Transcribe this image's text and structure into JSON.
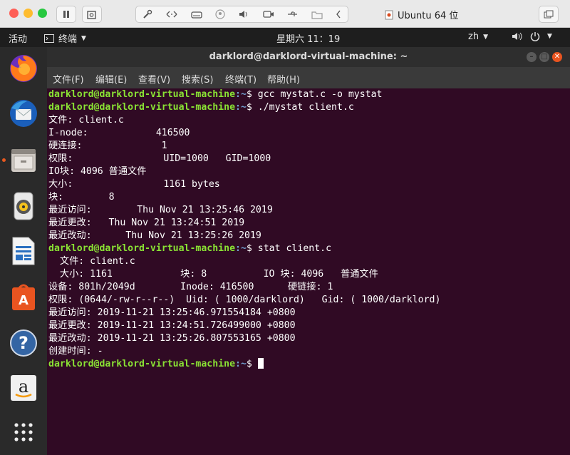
{
  "host": {
    "window_title": "Ubuntu 64 位"
  },
  "panel": {
    "activities": "活动",
    "app_name": "终端",
    "clock": "星期六 11：19",
    "input_method": "zh"
  },
  "terminal": {
    "title": "darklord@darklord-virtual-machine: ~",
    "menu": [
      "文件(F)",
      "编辑(E)",
      "查看(V)",
      "搜索(S)",
      "终端(T)",
      "帮助(H)"
    ],
    "prompt_user": "darklord@darklord-virtual-machine",
    "prompt_path": ":~",
    "prompt_symbol": "$ ",
    "lines": [
      {
        "type": "prompt",
        "cmd": "gcc mystat.c -o mystat"
      },
      {
        "type": "prompt",
        "cmd": "./mystat client.c"
      },
      {
        "type": "out",
        "text": "文件: client.c"
      },
      {
        "type": "out",
        "text": "I-node:            416500"
      },
      {
        "type": "out",
        "text": "硬连接:              1"
      },
      {
        "type": "out",
        "text": "权限:                UID=1000   GID=1000"
      },
      {
        "type": "out",
        "text": "IO块: 4096 普通文件"
      },
      {
        "type": "out",
        "text": "大小:                1161 bytes"
      },
      {
        "type": "out",
        "text": "块:        8"
      },
      {
        "type": "out",
        "text": "最近访问:        Thu Nov 21 13:25:46 2019"
      },
      {
        "type": "out",
        "text": "最近更改:   Thu Nov 21 13:24:51 2019"
      },
      {
        "type": "out",
        "text": "最近改动:      Thu Nov 21 13:25:26 2019"
      },
      {
        "type": "prompt",
        "cmd": "stat client.c"
      },
      {
        "type": "out",
        "text": "  文件: client.c"
      },
      {
        "type": "out",
        "text": "  大小: 1161            块: 8          IO 块: 4096   普通文件"
      },
      {
        "type": "out",
        "text": "设备: 801h/2049d        Inode: 416500      硬链接: 1"
      },
      {
        "type": "out",
        "text": "权限: (0644/-rw-r--r--)  Uid: ( 1000/darklord)   Gid: ( 1000/darklord)"
      },
      {
        "type": "out",
        "text": "最近访问: 2019-11-21 13:25:46.971554184 +0800"
      },
      {
        "type": "out",
        "text": "最近更改: 2019-11-21 13:24:51.726499000 +0800"
      },
      {
        "type": "out",
        "text": "最近改动: 2019-11-21 13:25:26.807553165 +0800"
      },
      {
        "type": "out",
        "text": "创建时间: -"
      },
      {
        "type": "prompt",
        "cmd": ""
      }
    ]
  },
  "dock": {
    "apps": [
      "firefox-icon",
      "thunderbird-icon",
      "files-icon",
      "rhythmbox-icon",
      "libreoffice-writer-icon",
      "software-center-icon",
      "help-icon",
      "amazon-icon",
      "show-applications-icon"
    ]
  },
  "colors": {
    "terminal_bg": "#300a24",
    "prompt_user": "#8ae234",
    "prompt_path": "#729fcf",
    "dock_bg": "#2a2a2a",
    "panel_bg": "#1e1e1e"
  }
}
